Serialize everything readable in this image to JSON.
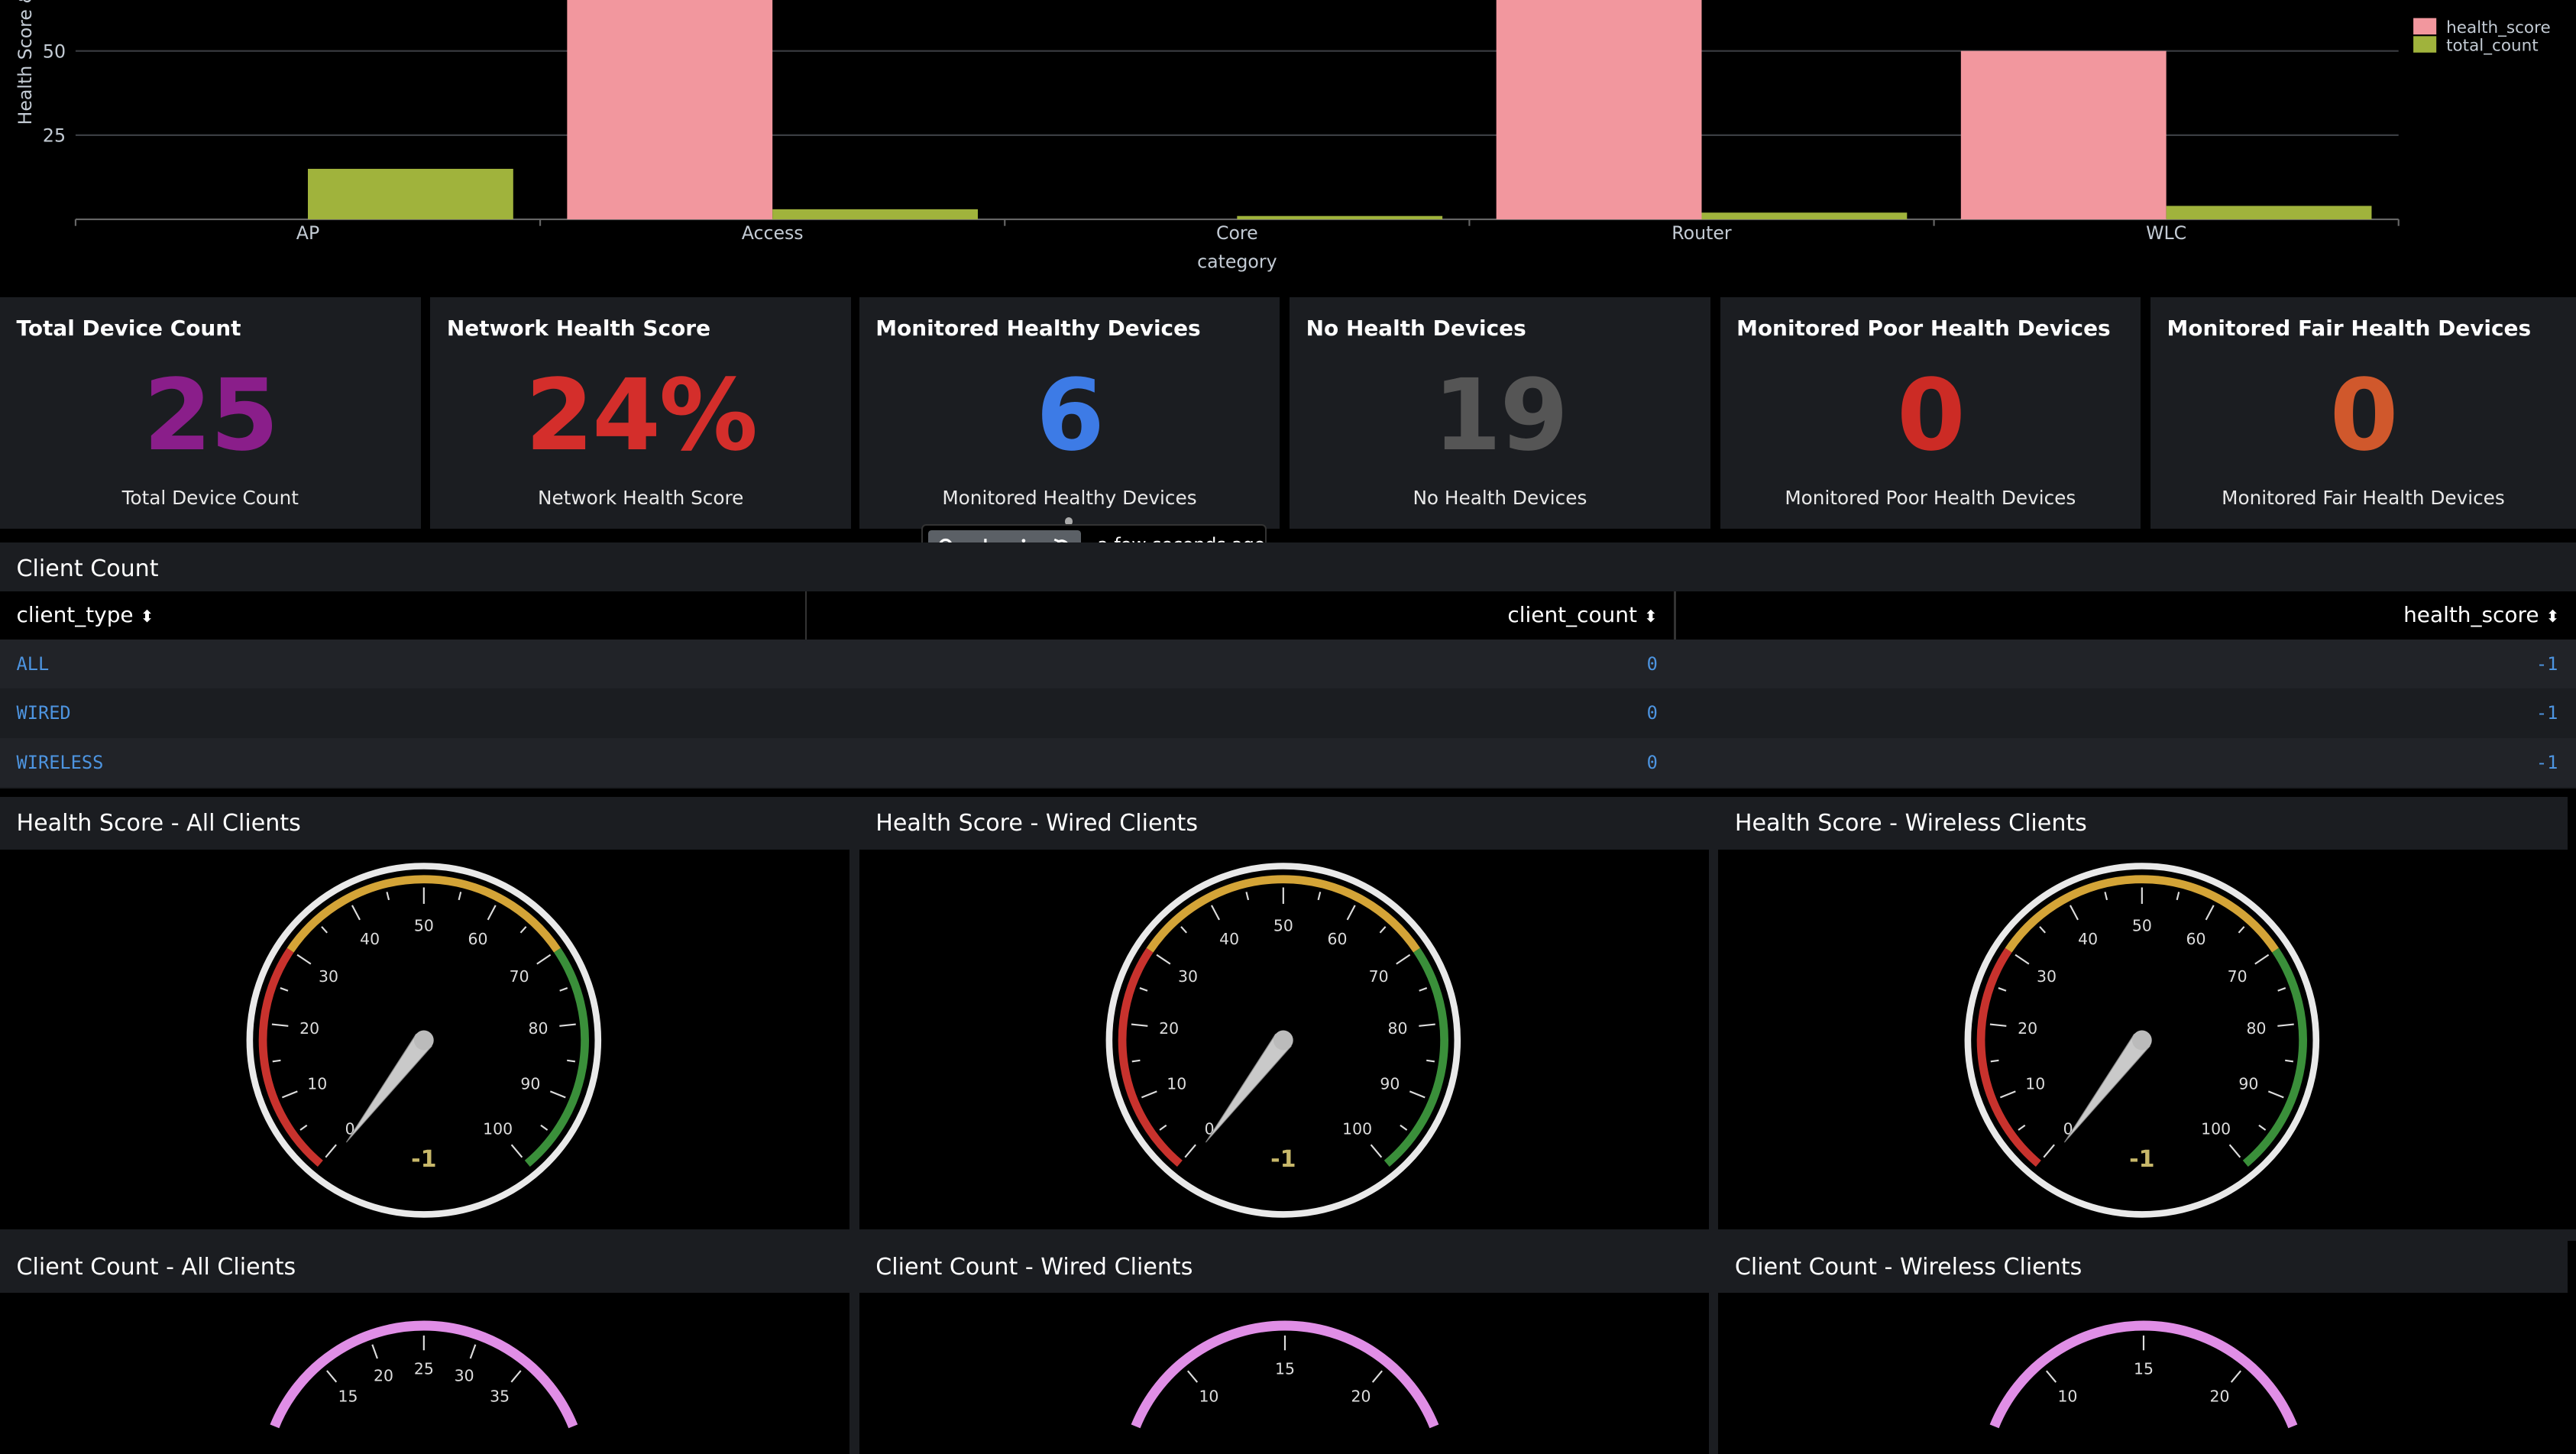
{
  "colors": {
    "health_score": "#f2979e",
    "total_count": "#a0b33c",
    "total_device": "#8a1e8a",
    "network_health": "#d42e2b",
    "healthy": "#3d7be6",
    "no_health": "#555555",
    "poor": "#cc2b25",
    "fair": "#d0582c",
    "gauge_red": "#c8322d",
    "gauge_yellow": "#d4a437",
    "gauge_green": "#3a8f3a",
    "gauge_pink": "#e08ee6"
  },
  "chart_data": {
    "type": "bar",
    "xlabel": "category",
    "ylabel": "Health Score &",
    "y_ticks": [
      "25",
      "50"
    ],
    "y_visible_range": [
      0,
      65
    ],
    "legend_position": "top-right",
    "categories": [
      "AP",
      "Access",
      "Core",
      "Router",
      "WLC"
    ],
    "series": [
      {
        "name": "health_score",
        "values": [
          0,
          100,
          0,
          100,
          50
        ]
      },
      {
        "name": "total_count",
        "values": [
          15,
          3,
          1,
          2,
          4
        ]
      }
    ]
  },
  "single_values": [
    {
      "title": "Total Device Count",
      "value": "25",
      "under": "Total Device Count",
      "color_key": "total_device"
    },
    {
      "title": "Network Health Score",
      "value": "24%",
      "under": "Network Health Score",
      "color_key": "network_health"
    },
    {
      "title": "Monitored Healthy Devices",
      "value": "6",
      "under": "Monitored Healthy Devices",
      "color_key": "healthy"
    },
    {
      "title": "No Health Devices",
      "value": "19",
      "under": "No Health Devices",
      "color_key": "no_health"
    },
    {
      "title": "Monitored Poor Health Devices",
      "value": "0",
      "under": "Monitored Poor Health Devices",
      "color_key": "poor"
    },
    {
      "title": "Monitored Fair Health Devices",
      "value": "0",
      "under": "Monitored Fair Health Devices",
      "color_key": "fair"
    }
  ],
  "toolbar": {
    "time": "a few seconds ago",
    "buttons": [
      "search-icon",
      "download-icon",
      "info-icon",
      "refresh-icon"
    ]
  },
  "client_table": {
    "title": "Client Count",
    "headers": [
      "client_type",
      "client_count",
      "health_score"
    ],
    "rows": [
      [
        "ALL",
        "0",
        "-1"
      ],
      [
        "WIRED",
        "0",
        "-1"
      ],
      [
        "WIRELESS",
        "0",
        "-1"
      ]
    ]
  },
  "health_gauges": [
    {
      "title": "Health Score - All Clients",
      "value": "-1"
    },
    {
      "title": "Health Score - Wired Clients",
      "value": "-1"
    },
    {
      "title": "Health Score - Wireless Clients",
      "value": "-1"
    }
  ],
  "health_gauge_ticks": [
    "0",
    "10",
    "20",
    "30",
    "40",
    "50",
    "60",
    "70",
    "80",
    "90",
    "100"
  ],
  "count_gauges": [
    {
      "title": "Client Count - All Clients",
      "ticks": [
        "15",
        "20",
        "25",
        "30",
        "35"
      ]
    },
    {
      "title": "Client Count - Wired Clients",
      "ticks": [
        "10",
        "15",
        "20"
      ]
    },
    {
      "title": "Client Count - Wireless Clients",
      "ticks": [
        "10",
        "15",
        "20"
      ]
    }
  ]
}
